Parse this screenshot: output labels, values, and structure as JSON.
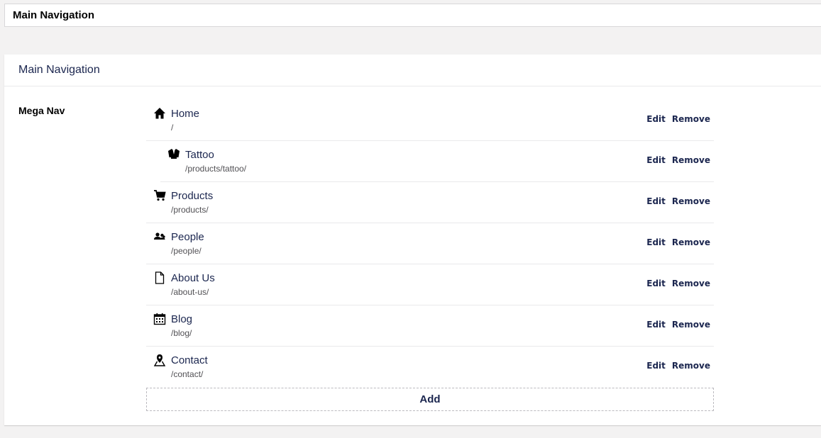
{
  "top_bar": {
    "title": "Main Navigation"
  },
  "panel": {
    "title": "Main Navigation",
    "property_label": "Mega Nav",
    "edit_label": "Edit",
    "remove_label": "Remove",
    "add_label": "Add",
    "items": [
      {
        "name": "Home",
        "url": "/",
        "icon": "home-icon",
        "child": false
      },
      {
        "name": "Tattoo",
        "url": "/products/tattoo/",
        "icon": "shirt-icon",
        "child": true
      },
      {
        "name": "Products",
        "url": "/products/",
        "icon": "shopping-cart-icon",
        "child": false
      },
      {
        "name": "People",
        "url": "/people/",
        "icon": "users-icon",
        "child": false
      },
      {
        "name": "About Us",
        "url": "/about-us/",
        "icon": "document-icon",
        "child": false
      },
      {
        "name": "Blog",
        "url": "/blog/",
        "icon": "calendar-icon",
        "child": false
      },
      {
        "name": "Contact",
        "url": "/contact/",
        "icon": "map-pin-icon",
        "child": false
      }
    ]
  }
}
